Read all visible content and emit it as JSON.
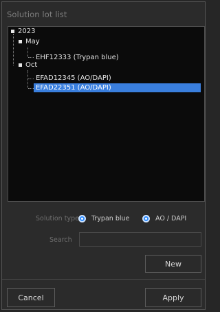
{
  "panel": {
    "title": "Solution lot list"
  },
  "tree": {
    "year": "2023",
    "months": [
      {
        "label": "May",
        "items": [
          "EHF12333 (Trypan blue)"
        ]
      },
      {
        "label": "Oct",
        "items": [
          "EFAD12345 (AO/DAPI)",
          "EFAD22351 (AO/DAPI)"
        ]
      }
    ],
    "selected_item": "EFAD22351 (AO/DAPI)"
  },
  "solution_type": {
    "label": "Solution type",
    "options": [
      "Trypan blue",
      "AO / DAPI"
    ]
  },
  "search": {
    "label": "Search",
    "value": ""
  },
  "buttons": {
    "new": "New",
    "cancel": "Cancel",
    "apply": "Apply"
  },
  "colors": {
    "selection": "#3a7fde",
    "radio": "#2f8cff",
    "background": "#2b2b2b",
    "tree_background": "#0b0b0b"
  }
}
